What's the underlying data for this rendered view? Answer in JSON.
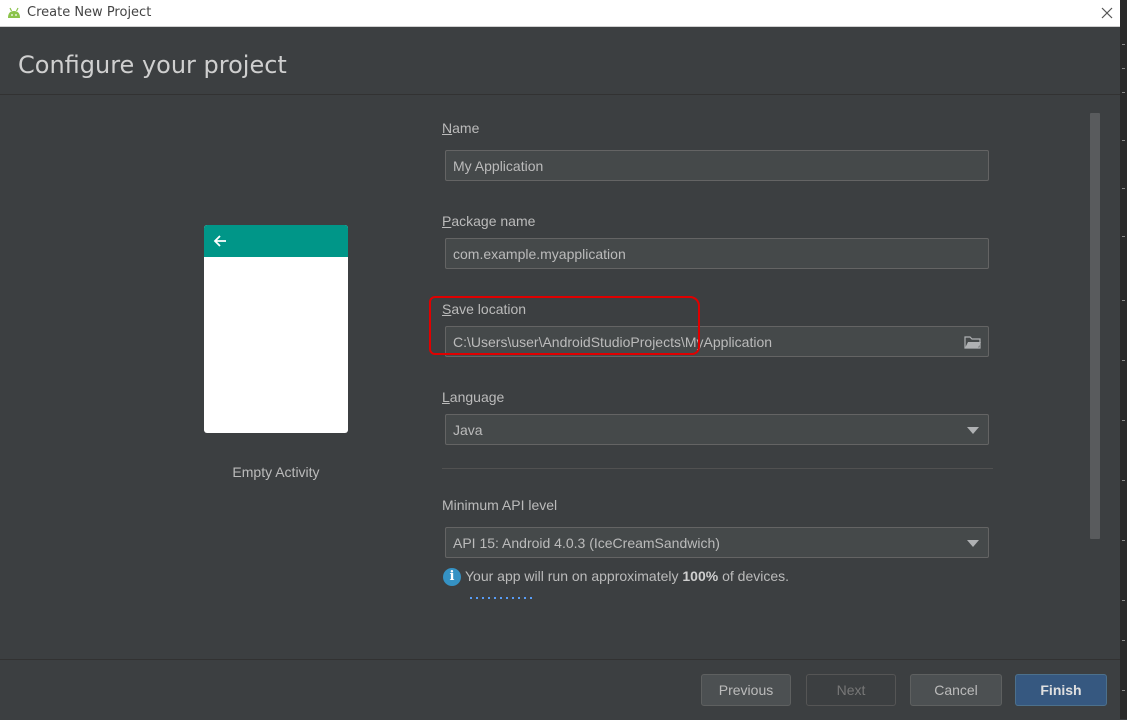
{
  "window": {
    "title": "Create New Project",
    "app_icon": "android-icon",
    "close_icon": "close-icon"
  },
  "page": {
    "heading": "Configure your project"
  },
  "preview": {
    "activity_name": "Empty Activity",
    "toolbar_color": "#009688",
    "back_icon": "arrow-left-icon"
  },
  "form": {
    "name": {
      "label_mnemonic": "N",
      "label_rest": "ame",
      "value": "My Application"
    },
    "package": {
      "label_mnemonic": "P",
      "label_rest": "ackage name",
      "value": "com.example.myapplication"
    },
    "save_location": {
      "label_mnemonic": "S",
      "label_rest": "ave location",
      "value": "C:\\Users\\user\\AndroidStudioProjects\\MyApplication",
      "icon": "folder-icon"
    },
    "language": {
      "label_mnemonic": "L",
      "label_rest": "anguage",
      "value": "Java"
    },
    "min_api": {
      "label": "Minimum API level",
      "value": "API 15: Android 4.0.3 (IceCreamSandwich)"
    },
    "info": {
      "prefix": "Your app will run on approximately ",
      "percent": "100%",
      "suffix": " of devices."
    }
  },
  "footer": {
    "previous": "Previous",
    "next": "Next",
    "cancel": "Cancel",
    "finish": "Finish"
  },
  "colors": {
    "background": "#3c3f41",
    "primary_button": "#365880",
    "highlight_annotation": "#e00000"
  }
}
